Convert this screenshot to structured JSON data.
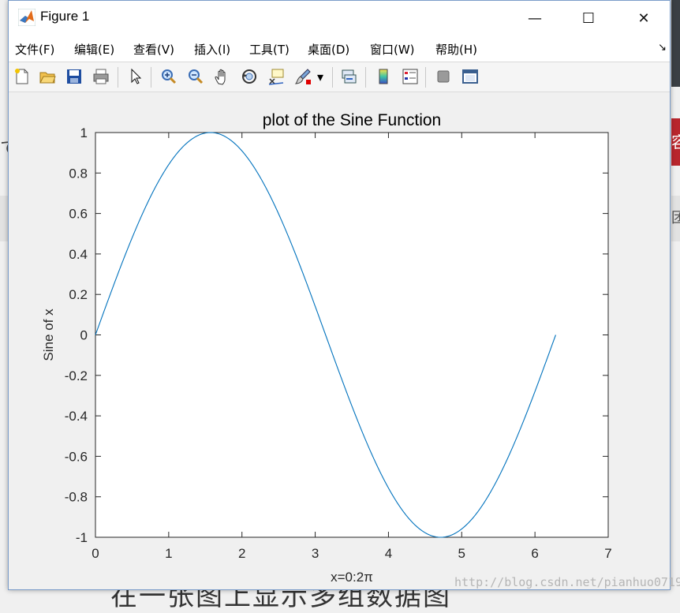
{
  "background": {
    "left_char": "て",
    "right_badge_char": "容",
    "right_band_char": "团",
    "bottom_text": "在一张图上显示多组数据图"
  },
  "window": {
    "title": "Figure 1",
    "controls": {
      "minimize": "—",
      "maximize": "☐",
      "close": "✕"
    }
  },
  "menu": {
    "items": [
      "文件(F)",
      "编辑(E)",
      "查看(V)",
      "插入(I)",
      "工具(T)",
      "桌面(D)",
      "窗口(W)",
      "帮助(H)"
    ],
    "overflow_icon": "↘"
  },
  "toolbar": {
    "icons": [
      "new-figure-icon",
      "open-file-icon",
      "save-icon",
      "print-icon",
      "edit-plot-arrow-icon",
      "zoom-in-icon",
      "zoom-out-icon",
      "pan-hand-icon",
      "rotate-3d-icon",
      "data-cursor-icon",
      "brush-icon",
      "link-plot-icon",
      "colorbar-icon",
      "legend-icon",
      "hide-plot-tools-icon",
      "show-plot-tools-icon"
    ],
    "brush_dropdown": "▾"
  },
  "chart_data": {
    "type": "line",
    "title": "plot of the Sine Function",
    "xlabel": "x=0:2π",
    "ylabel": "Sine of x",
    "xlim": [
      0,
      7
    ],
    "ylim": [
      -1,
      1
    ],
    "xticks": [
      "0",
      "1",
      "2",
      "3",
      "4",
      "5",
      "6",
      "7"
    ],
    "yticks": [
      "1",
      "0.8",
      "0.6",
      "0.4",
      "0.2",
      "0",
      "-0.2",
      "-0.4",
      "-0.6",
      "-0.8",
      "-1"
    ],
    "grid": false,
    "series": [
      {
        "function": "sin(x)",
        "x_range": [
          0,
          6.2832
        ],
        "color": "#0072bd"
      }
    ]
  },
  "watermark": "http://blog.csdn.net/pianhuo0719"
}
